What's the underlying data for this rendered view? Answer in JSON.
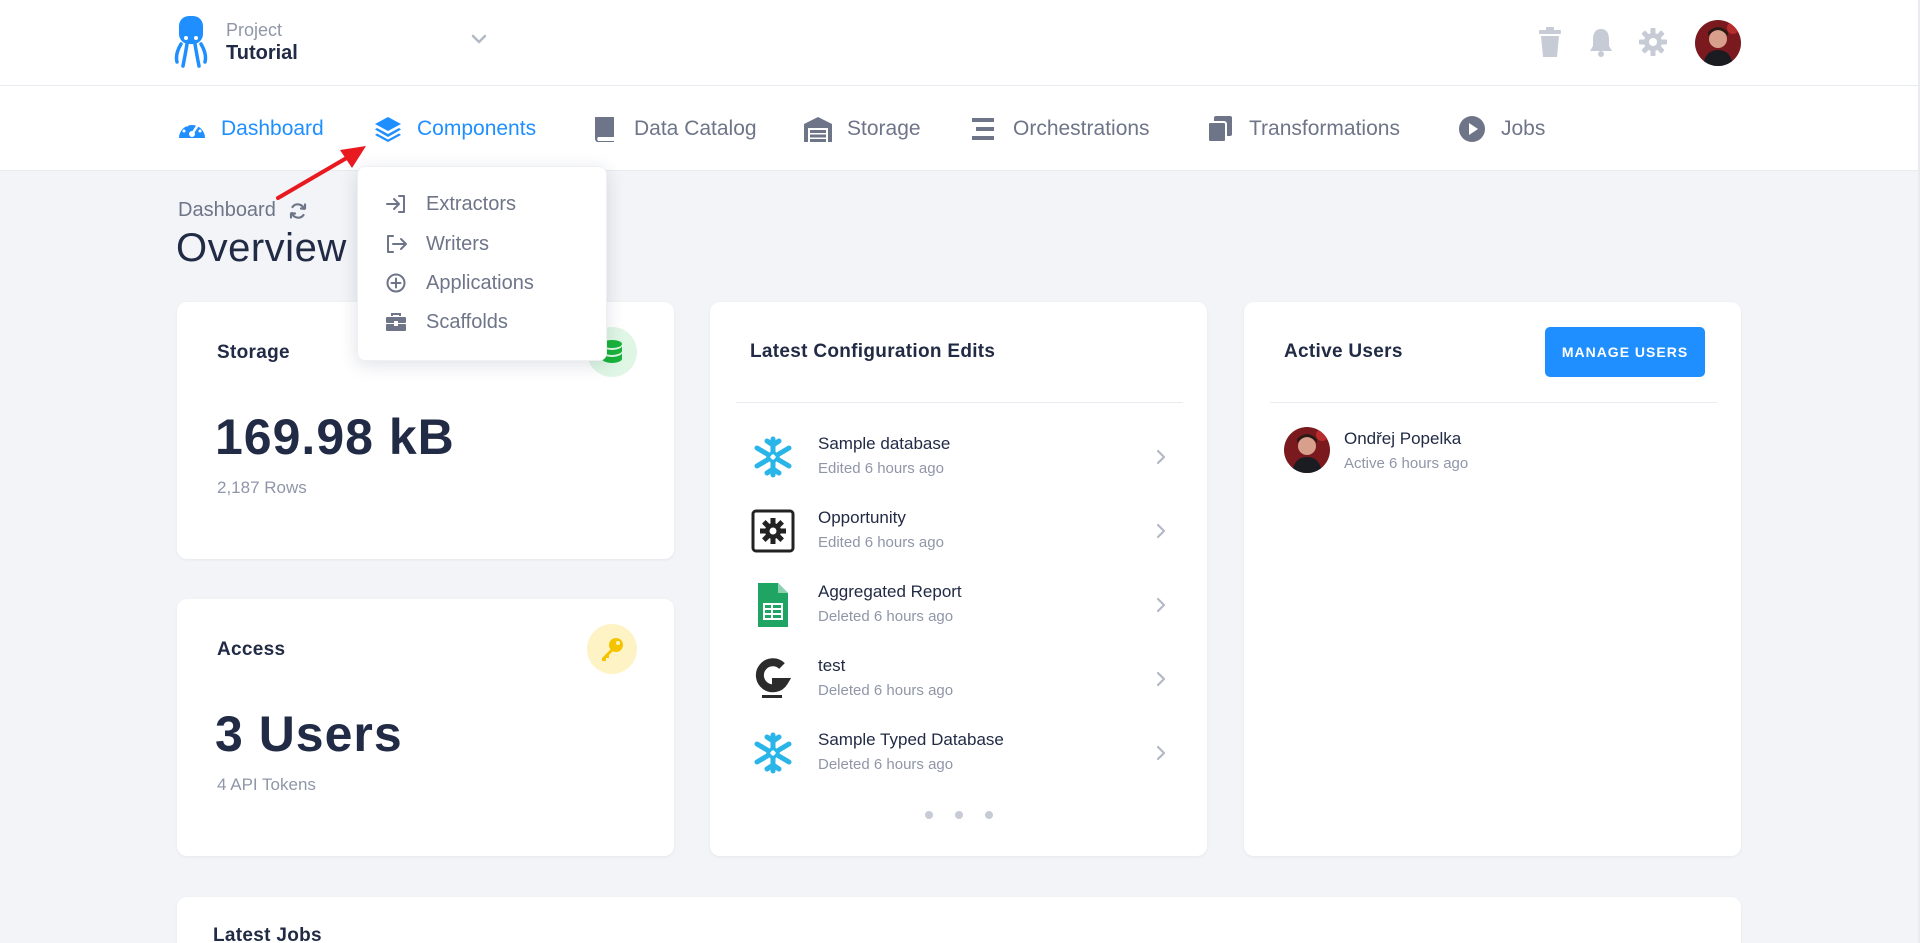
{
  "header": {
    "project_label": "Project",
    "project_name": "Tutorial"
  },
  "nav": [
    {
      "label": "Dashboard",
      "icon": "speedometer-icon"
    },
    {
      "label": "Components",
      "icon": "layers-icon"
    },
    {
      "label": "Data Catalog",
      "icon": "book-icon"
    },
    {
      "label": "Storage",
      "icon": "warehouse-icon"
    },
    {
      "label": "Orchestrations",
      "icon": "bars-icon"
    },
    {
      "label": "Transformations",
      "icon": "copy-icon"
    },
    {
      "label": "Jobs",
      "icon": "play-circle-icon"
    }
  ],
  "components_menu": [
    {
      "label": "Extractors",
      "icon": "sign-in-icon"
    },
    {
      "label": "Writers",
      "icon": "sign-out-icon"
    },
    {
      "label": "Applications",
      "icon": "plus-circle-icon"
    },
    {
      "label": "Scaffolds",
      "icon": "toolbox-icon"
    }
  ],
  "breadcrumb": "Dashboard",
  "page_title": "Overview",
  "storage": {
    "title": "Storage",
    "value": "169.98 kB",
    "rows": "2,187 Rows"
  },
  "access": {
    "title": "Access",
    "value": "3 Users",
    "tokens": "4 API Tokens"
  },
  "config_edits": {
    "title": "Latest Configuration Edits",
    "items": [
      {
        "name": "Sample database",
        "meta": "Edited 6 hours ago",
        "icon": "snowflake-icon"
      },
      {
        "name": "Opportunity",
        "meta": "Edited 6 hours ago",
        "icon": "gear-box-icon"
      },
      {
        "name": "Aggregated Report",
        "meta": "Deleted 6 hours ago",
        "icon": "google-sheets-icon"
      },
      {
        "name": "test",
        "meta": "Deleted 6 hours ago",
        "icon": "gooddata-icon"
      },
      {
        "name": "Sample Typed Database",
        "meta": "Deleted 6 hours ago",
        "icon": "snowflake-icon"
      }
    ]
  },
  "active_users": {
    "title": "Active Users",
    "button": "MANAGE USERS",
    "users": [
      {
        "name": "Ondřej Popelka",
        "meta": "Active 6 hours ago"
      }
    ]
  },
  "latest_jobs": {
    "title": "Latest Jobs"
  },
  "colors": {
    "accent": "#1f8fff",
    "storage_badge": "#dff6e4",
    "access_badge": "#fdf3c4"
  }
}
